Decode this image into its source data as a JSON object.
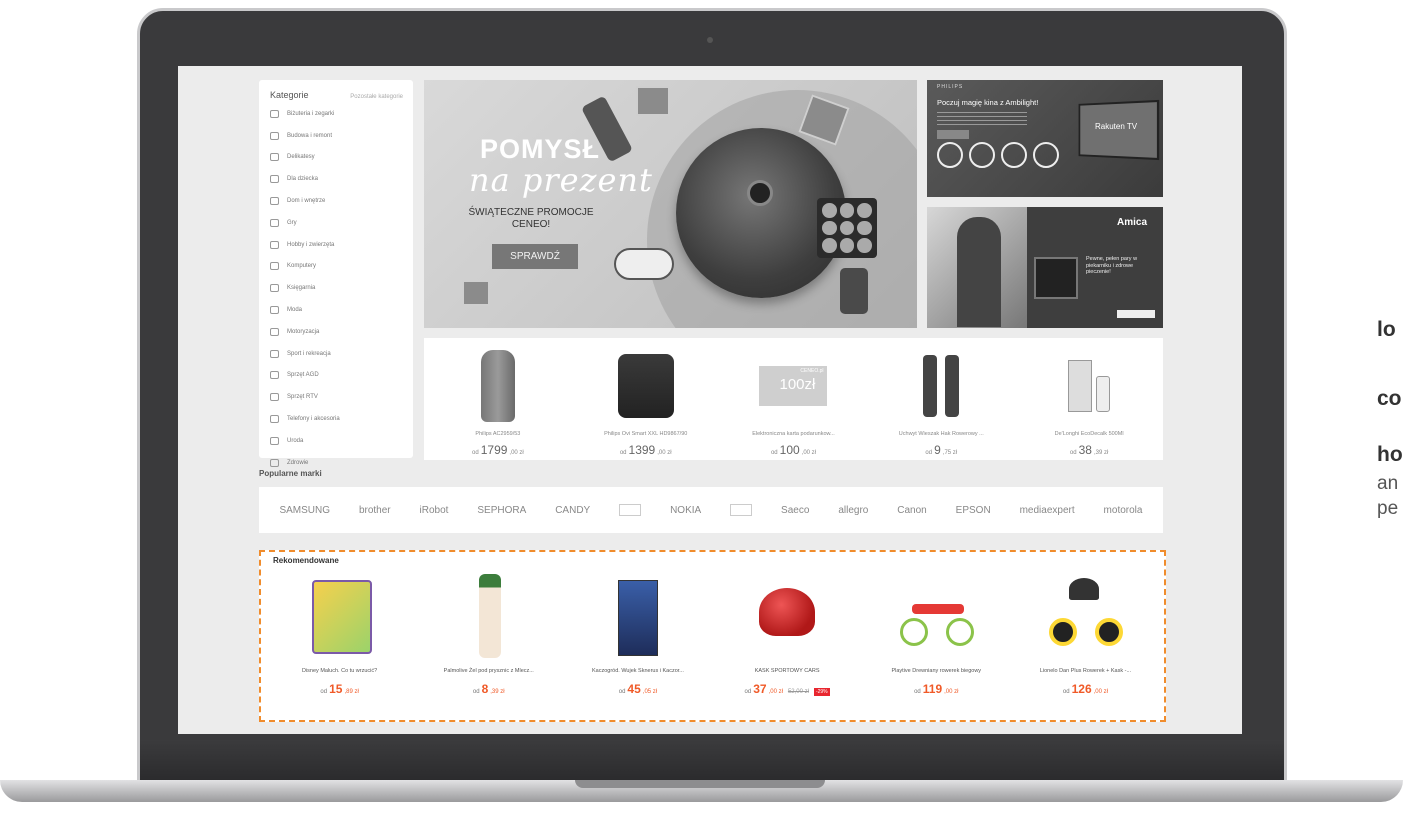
{
  "sidebar": {
    "title": "Kategorie",
    "more_link": "Pozostałe kategorie",
    "items": [
      {
        "label": "Biżuteria i zegarki",
        "icon": "watch-icon"
      },
      {
        "label": "Budowa i remont",
        "icon": "hammer-icon"
      },
      {
        "label": "Delikatesy",
        "icon": "cup-icon"
      },
      {
        "label": "Dla dziecka",
        "icon": "toy-icon"
      },
      {
        "label": "Dom i wnętrze",
        "icon": "lamp-icon"
      },
      {
        "label": "Gry",
        "icon": "gamepad-icon"
      },
      {
        "label": "Hobby i zwierzęta",
        "icon": "paw-icon"
      },
      {
        "label": "Komputery",
        "icon": "monitor-icon"
      },
      {
        "label": "Księgarnia",
        "icon": "book-icon"
      },
      {
        "label": "Moda",
        "icon": "shirt-icon"
      },
      {
        "label": "Motoryzacja",
        "icon": "car-icon"
      },
      {
        "label": "Sport i rekreacja",
        "icon": "ball-icon"
      },
      {
        "label": "Sprzęt AGD",
        "icon": "fridge-icon"
      },
      {
        "label": "Sprzęt RTV",
        "icon": "tv-icon"
      },
      {
        "label": "Telefony i akcesoria",
        "icon": "phone-icon"
      },
      {
        "label": "Uroda",
        "icon": "lipstick-icon"
      },
      {
        "label": "Zdrowie",
        "icon": "pill-icon"
      }
    ]
  },
  "hero": {
    "title": "POMYSŁ",
    "subtitle": "na prezent",
    "promo_line1": "ŚWIĄTECZNE PROMOCJE",
    "promo_line2": "CENEO!",
    "button": "SPRAWDŹ"
  },
  "philips_banner": {
    "brand": "PHILIPS",
    "title": "Poczuj magię kina z Ambilight!",
    "tv_logo": "Rakuten TV"
  },
  "amica_banner": {
    "brand": "Amica",
    "slogan": "Pewne, pełen pary w piekarniku i zdrowe pieczenie!"
  },
  "products": [
    {
      "name": "Philips AC2959/53",
      "od": "od",
      "price": "1799",
      "dec": ",00 zł"
    },
    {
      "name": "Philips Ovi Smart XXL HD9867/90",
      "od": "od",
      "price": "1399",
      "dec": ",00 zł"
    },
    {
      "name": "Elektroniczna karta podarunkow...",
      "od": "od",
      "price": "100",
      "dec": ",00 zł",
      "card_logo": "CENEO.pl",
      "card_value": "100zł"
    },
    {
      "name": "Uchwyt Wieszak Hak Rowerowy ...",
      "od": "od",
      "price": "9",
      "dec": ",75 zł"
    },
    {
      "name": "De'Longhi EcoDecalk 500Ml",
      "od": "od",
      "price": "38",
      "dec": ",39 zł"
    }
  ],
  "brands_section": {
    "title": "Popularne marki",
    "brands": [
      "SAMSUNG",
      "brother",
      "iRobot",
      "SEPHORA",
      "CANDY",
      "",
      "NOKIA",
      "",
      "Saeco",
      "allegro",
      "Canon",
      "EPSON",
      "mediaexpert",
      "motorola"
    ]
  },
  "recommended": {
    "title": "Rekomendowane",
    "items": [
      {
        "name": "Disney Maluch. Co tu wrzucić?",
        "od": "od",
        "price": "15",
        "dec": ",89 zł"
      },
      {
        "name": "Palmolive Żel pod prysznic z Mlecz...",
        "od": "od",
        "price": "8",
        "dec": ",39 zł"
      },
      {
        "name": "Kaczogród. Wujek Sknerus i Kaczor...",
        "od": "od",
        "price": "45",
        "dec": ",05 zł"
      },
      {
        "name": "KASK SPORTOWY CARS",
        "od": "od",
        "price": "37",
        "dec": ",00 zł",
        "old": "52,00 zł",
        "discount": "-29%"
      },
      {
        "name": "Playtive Drewniany rowerek biegowy",
        "od": "od",
        "price": "119",
        "dec": ",00 zł"
      },
      {
        "name": "Lionelo Dan Plus Rowerek + Kask -...",
        "od": "od",
        "price": "126",
        "dec": ",00 zł"
      }
    ]
  },
  "side_text": {
    "line1": "lo",
    "line2": "co",
    "line3": "ho",
    "line4": "an",
    "line5": "pe"
  },
  "colors": {
    "accent": "#f05a28",
    "dashed_border": "#f08c2c",
    "discount": "#e8262f"
  }
}
